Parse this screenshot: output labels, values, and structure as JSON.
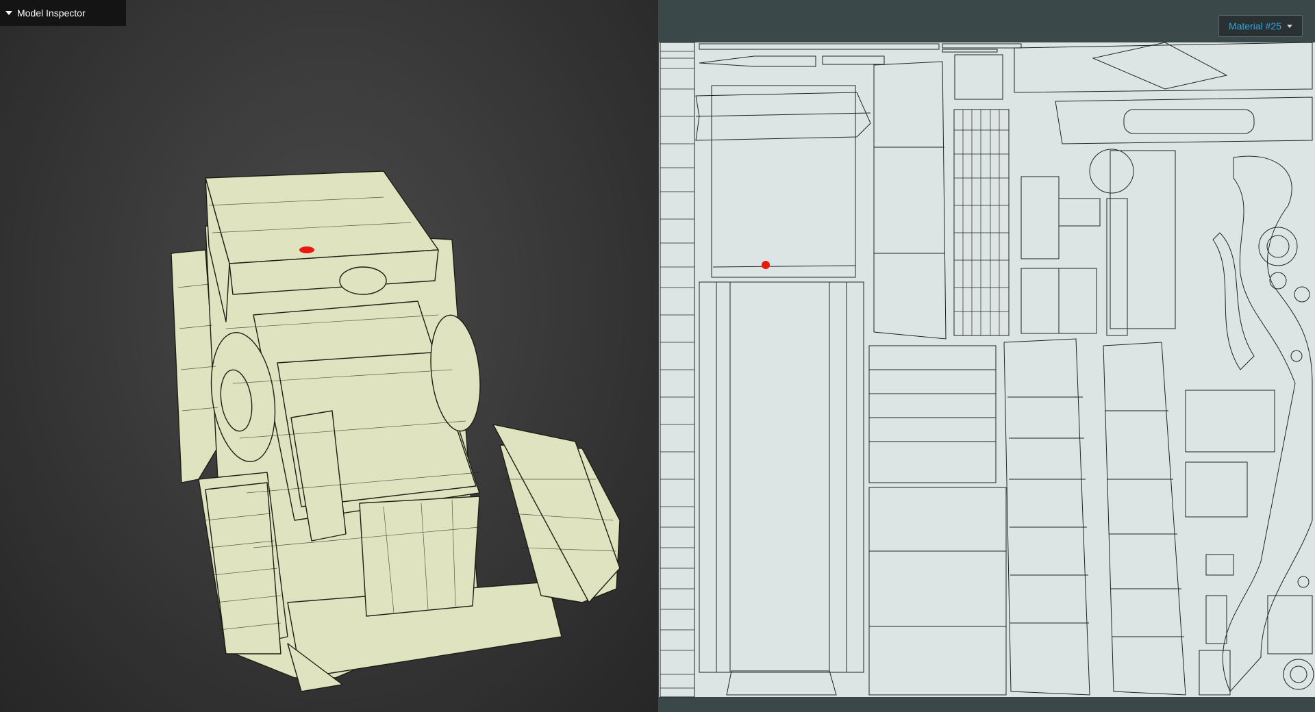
{
  "viewport": {
    "inspector_label": "Model Inspector",
    "colors": {
      "model_fill": "#dfe3bf",
      "wire": "#1d1f14",
      "marker": "#e8190f"
    }
  },
  "uv_editor": {
    "material_label": "Material #25",
    "colors": {
      "sheet": "#dde4e4",
      "line": "#1d2424",
      "accent": "#2fa6e0"
    }
  }
}
